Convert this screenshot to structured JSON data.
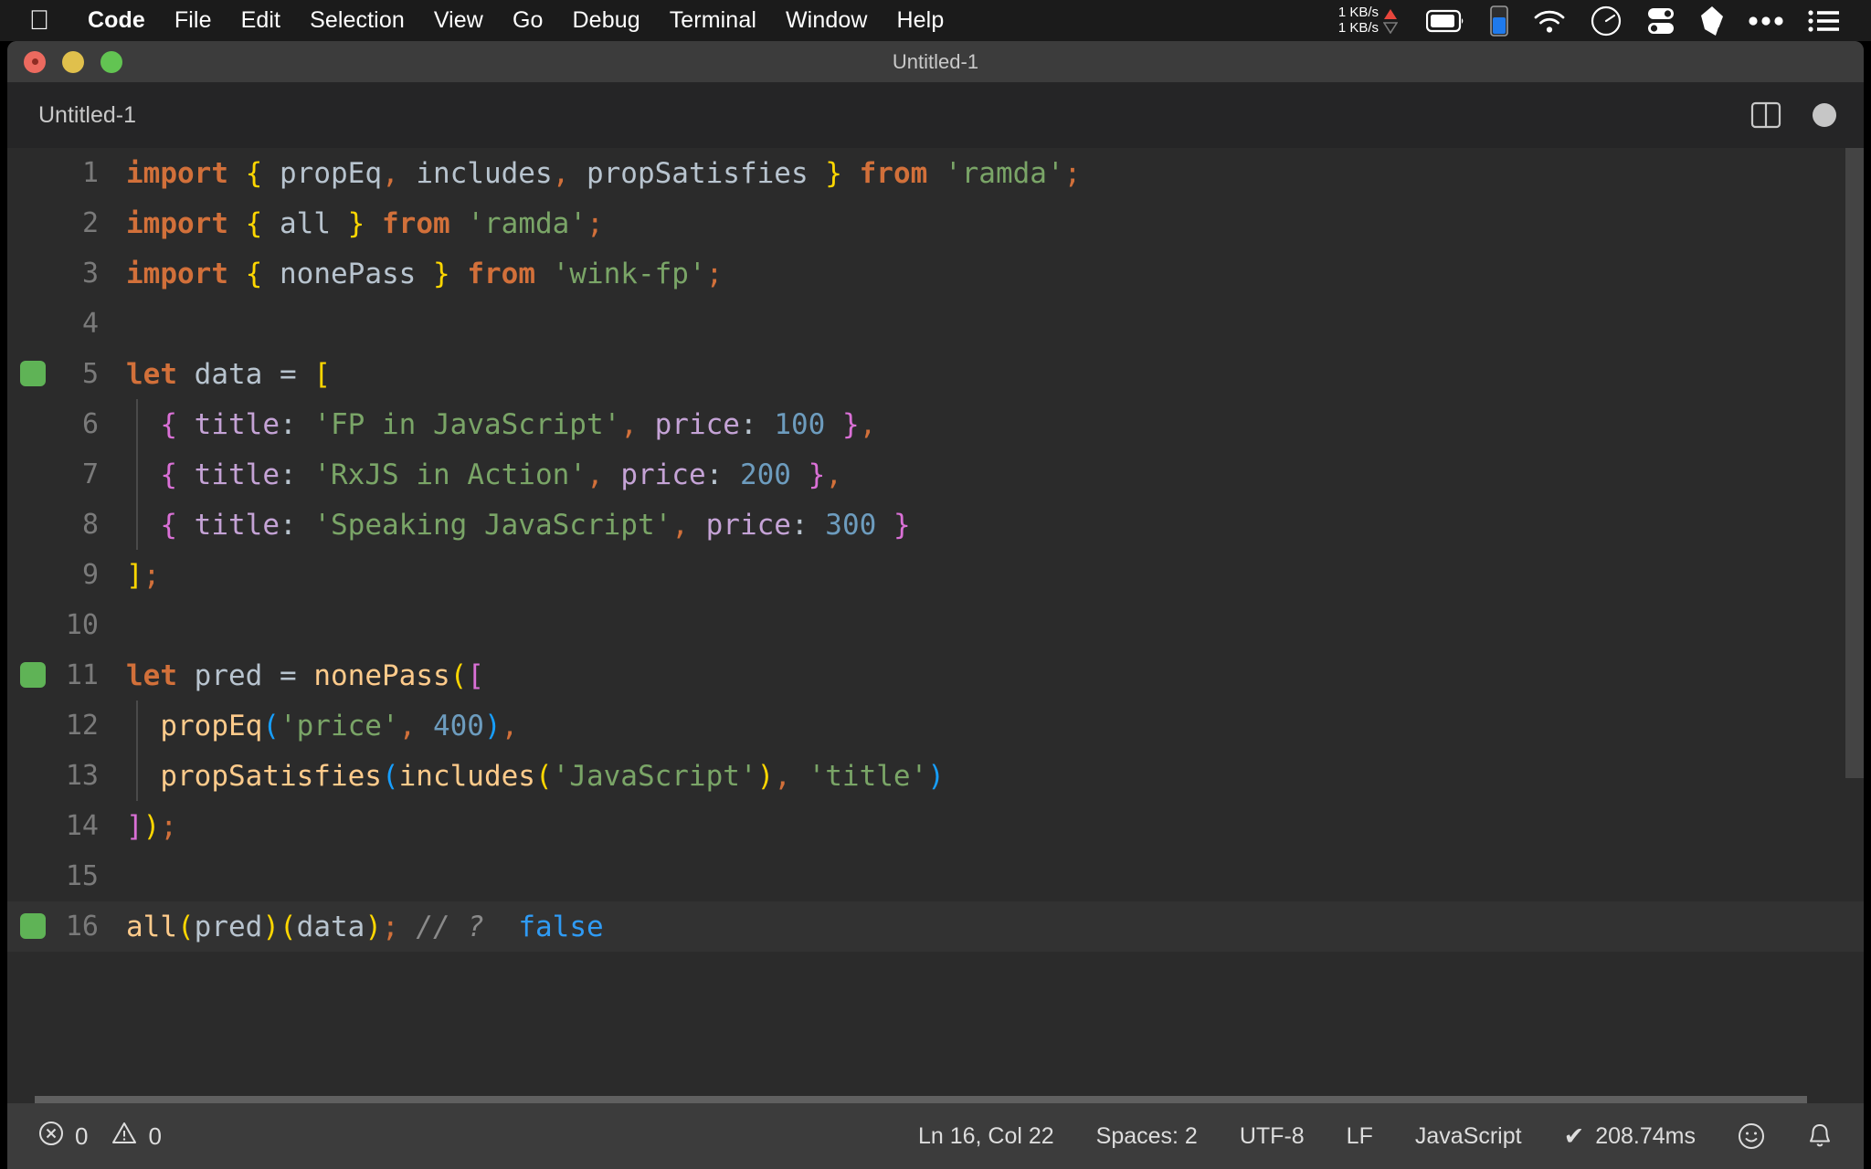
{
  "menubar": {
    "apple_icon": "apple-logo",
    "items": [
      {
        "label": "Code",
        "bold": true
      },
      {
        "label": "File",
        "bold": false
      },
      {
        "label": "Edit",
        "bold": false
      },
      {
        "label": "Selection",
        "bold": false
      },
      {
        "label": "View",
        "bold": false
      },
      {
        "label": "Go",
        "bold": false
      },
      {
        "label": "Debug",
        "bold": false
      },
      {
        "label": "Terminal",
        "bold": false
      },
      {
        "label": "Window",
        "bold": false
      },
      {
        "label": "Help",
        "bold": false
      }
    ],
    "network": {
      "upload": "1 KB/s",
      "download": "1 KB/s",
      "upload_color": "#e8463c",
      "download_color": "#6e6e6e"
    },
    "status_icons": [
      "battery-icon",
      "battery-level-icon",
      "wifi-icon",
      "speedometer-icon",
      "toggles-icon",
      "shard-icon",
      "ellipsis-icon",
      "list-icon"
    ]
  },
  "window": {
    "title": "Untitled-1",
    "traffic_lights": [
      "close-button",
      "minimize-button",
      "maximize-button"
    ]
  },
  "editor": {
    "tab_label": "Untitled-1",
    "actions": [
      "split-editor-icon",
      "unsaved-dot-icon"
    ],
    "language_mode": "JavaScript",
    "quokka_lines": [
      5,
      11,
      16
    ],
    "current_line": 16,
    "lines": [
      {
        "n": 1,
        "tokens": [
          {
            "t": "import",
            "c": "kw"
          },
          {
            "t": " ",
            "c": "plain"
          },
          {
            "t": "{",
            "c": "b1"
          },
          {
            "t": " ",
            "c": "plain"
          },
          {
            "t": "propEq",
            "c": "plain"
          },
          {
            "t": ",",
            "c": "punc"
          },
          {
            "t": " ",
            "c": "plain"
          },
          {
            "t": "includes",
            "c": "plain"
          },
          {
            "t": ",",
            "c": "punc"
          },
          {
            "t": " ",
            "c": "plain"
          },
          {
            "t": "propSatisfies",
            "c": "plain"
          },
          {
            "t": " ",
            "c": "plain"
          },
          {
            "t": "}",
            "c": "b1"
          },
          {
            "t": " ",
            "c": "plain"
          },
          {
            "t": "from",
            "c": "kw"
          },
          {
            "t": " ",
            "c": "plain"
          },
          {
            "t": "'ramda'",
            "c": "str"
          },
          {
            "t": ";",
            "c": "punc"
          }
        ]
      },
      {
        "n": 2,
        "tokens": [
          {
            "t": "import",
            "c": "kw"
          },
          {
            "t": " ",
            "c": "plain"
          },
          {
            "t": "{",
            "c": "b1"
          },
          {
            "t": " ",
            "c": "plain"
          },
          {
            "t": "all",
            "c": "plain"
          },
          {
            "t": " ",
            "c": "plain"
          },
          {
            "t": "}",
            "c": "b1"
          },
          {
            "t": " ",
            "c": "plain"
          },
          {
            "t": "from",
            "c": "kw"
          },
          {
            "t": " ",
            "c": "plain"
          },
          {
            "t": "'ramda'",
            "c": "str"
          },
          {
            "t": ";",
            "c": "punc"
          }
        ]
      },
      {
        "n": 3,
        "tokens": [
          {
            "t": "import",
            "c": "kw"
          },
          {
            "t": " ",
            "c": "plain"
          },
          {
            "t": "{",
            "c": "b1"
          },
          {
            "t": " ",
            "c": "plain"
          },
          {
            "t": "nonePass",
            "c": "plain"
          },
          {
            "t": " ",
            "c": "plain"
          },
          {
            "t": "}",
            "c": "b1"
          },
          {
            "t": " ",
            "c": "plain"
          },
          {
            "t": "from",
            "c": "kw"
          },
          {
            "t": " ",
            "c": "plain"
          },
          {
            "t": "'wink-fp'",
            "c": "str"
          },
          {
            "t": ";",
            "c": "punc"
          }
        ]
      },
      {
        "n": 4,
        "tokens": []
      },
      {
        "n": 5,
        "tokens": [
          {
            "t": "let",
            "c": "kw"
          },
          {
            "t": " ",
            "c": "plain"
          },
          {
            "t": "data",
            "c": "plain"
          },
          {
            "t": " ",
            "c": "plain"
          },
          {
            "t": "=",
            "c": "plain"
          },
          {
            "t": " ",
            "c": "plain"
          },
          {
            "t": "[",
            "c": "b1"
          }
        ]
      },
      {
        "n": 6,
        "indent": 1,
        "tokens": [
          {
            "t": "  ",
            "c": "plain"
          },
          {
            "t": "{",
            "c": "b2"
          },
          {
            "t": " ",
            "c": "plain"
          },
          {
            "t": "title",
            "c": "prop"
          },
          {
            "t": ":",
            "c": "colon"
          },
          {
            "t": " ",
            "c": "plain"
          },
          {
            "t": "'FP in JavaScript'",
            "c": "str"
          },
          {
            "t": ",",
            "c": "punc"
          },
          {
            "t": " ",
            "c": "plain"
          },
          {
            "t": "price",
            "c": "prop"
          },
          {
            "t": ":",
            "c": "colon"
          },
          {
            "t": " ",
            "c": "plain"
          },
          {
            "t": "100",
            "c": "num"
          },
          {
            "t": " ",
            "c": "plain"
          },
          {
            "t": "}",
            "c": "b2"
          },
          {
            "t": ",",
            "c": "punc"
          }
        ]
      },
      {
        "n": 7,
        "indent": 1,
        "tokens": [
          {
            "t": "  ",
            "c": "plain"
          },
          {
            "t": "{",
            "c": "b2"
          },
          {
            "t": " ",
            "c": "plain"
          },
          {
            "t": "title",
            "c": "prop"
          },
          {
            "t": ":",
            "c": "colon"
          },
          {
            "t": " ",
            "c": "plain"
          },
          {
            "t": "'RxJS in Action'",
            "c": "str"
          },
          {
            "t": ",",
            "c": "punc"
          },
          {
            "t": " ",
            "c": "plain"
          },
          {
            "t": "price",
            "c": "prop"
          },
          {
            "t": ":",
            "c": "colon"
          },
          {
            "t": " ",
            "c": "plain"
          },
          {
            "t": "200",
            "c": "num"
          },
          {
            "t": " ",
            "c": "plain"
          },
          {
            "t": "}",
            "c": "b2"
          },
          {
            "t": ",",
            "c": "punc"
          }
        ]
      },
      {
        "n": 8,
        "indent": 1,
        "tokens": [
          {
            "t": "  ",
            "c": "plain"
          },
          {
            "t": "{",
            "c": "b2"
          },
          {
            "t": " ",
            "c": "plain"
          },
          {
            "t": "title",
            "c": "prop"
          },
          {
            "t": ":",
            "c": "colon"
          },
          {
            "t": " ",
            "c": "plain"
          },
          {
            "t": "'Speaking JavaScript'",
            "c": "str"
          },
          {
            "t": ",",
            "c": "punc"
          },
          {
            "t": " ",
            "c": "plain"
          },
          {
            "t": "price",
            "c": "prop"
          },
          {
            "t": ":",
            "c": "colon"
          },
          {
            "t": " ",
            "c": "plain"
          },
          {
            "t": "300",
            "c": "num"
          },
          {
            "t": " ",
            "c": "plain"
          },
          {
            "t": "}",
            "c": "b2"
          }
        ]
      },
      {
        "n": 9,
        "tokens": [
          {
            "t": "]",
            "c": "b1"
          },
          {
            "t": ";",
            "c": "punc"
          }
        ]
      },
      {
        "n": 10,
        "tokens": []
      },
      {
        "n": 11,
        "tokens": [
          {
            "t": "let",
            "c": "kw"
          },
          {
            "t": " ",
            "c": "plain"
          },
          {
            "t": "pred",
            "c": "plain"
          },
          {
            "t": " ",
            "c": "plain"
          },
          {
            "t": "=",
            "c": "plain"
          },
          {
            "t": " ",
            "c": "plain"
          },
          {
            "t": "nonePass",
            "c": "fn"
          },
          {
            "t": "(",
            "c": "b1"
          },
          {
            "t": "[",
            "c": "b2"
          }
        ]
      },
      {
        "n": 12,
        "indent": 1,
        "tokens": [
          {
            "t": "  ",
            "c": "plain"
          },
          {
            "t": "propEq",
            "c": "fn"
          },
          {
            "t": "(",
            "c": "b3"
          },
          {
            "t": "'price'",
            "c": "str"
          },
          {
            "t": ",",
            "c": "punc"
          },
          {
            "t": " ",
            "c": "plain"
          },
          {
            "t": "400",
            "c": "num"
          },
          {
            "t": ")",
            "c": "b3"
          },
          {
            "t": ",",
            "c": "punc"
          }
        ]
      },
      {
        "n": 13,
        "indent": 1,
        "tokens": [
          {
            "t": "  ",
            "c": "plain"
          },
          {
            "t": "propSatisfies",
            "c": "fn"
          },
          {
            "t": "(",
            "c": "b3"
          },
          {
            "t": "includes",
            "c": "fn"
          },
          {
            "t": "(",
            "c": "b1"
          },
          {
            "t": "'JavaScript'",
            "c": "str"
          },
          {
            "t": ")",
            "c": "b1"
          },
          {
            "t": ",",
            "c": "punc"
          },
          {
            "t": " ",
            "c": "plain"
          },
          {
            "t": "'title'",
            "c": "str"
          },
          {
            "t": ")",
            "c": "b3"
          }
        ]
      },
      {
        "n": 14,
        "tokens": [
          {
            "t": "]",
            "c": "b2"
          },
          {
            "t": ")",
            "c": "b1"
          },
          {
            "t": ";",
            "c": "punc"
          }
        ]
      },
      {
        "n": 15,
        "tokens": []
      },
      {
        "n": 16,
        "tokens": [
          {
            "t": "all",
            "c": "fn"
          },
          {
            "t": "(",
            "c": "b1"
          },
          {
            "t": "pred",
            "c": "plain"
          },
          {
            "t": ")",
            "c": "b1"
          },
          {
            "t": "(",
            "c": "b1"
          },
          {
            "t": "data",
            "c": "plain"
          },
          {
            "t": ")",
            "c": "b1"
          },
          {
            "t": ";",
            "c": "punc"
          },
          {
            "t": " ",
            "c": "plain"
          },
          {
            "t": "// ?",
            "c": "comment"
          },
          {
            "t": "  ",
            "c": "plain"
          },
          {
            "t": "false",
            "c": "qval"
          }
        ]
      }
    ]
  },
  "statusbar": {
    "errors_icon": "error-circle-icon",
    "errors_count": "0",
    "warnings_icon": "warning-triangle-icon",
    "warnings_count": "0",
    "cursor_position": "Ln 16, Col 22",
    "indentation": "Spaces: 2",
    "encoding": "UTF-8",
    "eol": "LF",
    "language": "JavaScript",
    "quokka_check": "✔",
    "quokka_time": "208.74ms",
    "feedback_icon": "smiley-icon",
    "notifications_icon": "bell-icon"
  },
  "colors": {
    "editor_bg": "#2b2b2b",
    "sidebar_bg": "#252526",
    "statusbar_bg": "#3c3c3c",
    "menubar_bg": "#1b1b1b",
    "quokka_green": "#5fb356",
    "keyword_orange": "#d2703a",
    "string_green": "#7aa567",
    "number_blue": "#6d9cbe",
    "property_purple": "#c5a3d6",
    "function_tan": "#ffcb8b",
    "bracket_1": "#ffd700",
    "bracket_2": "#da70d6",
    "bracket_3": "#179fff",
    "quokka_value_blue": "#2f9bf5"
  }
}
